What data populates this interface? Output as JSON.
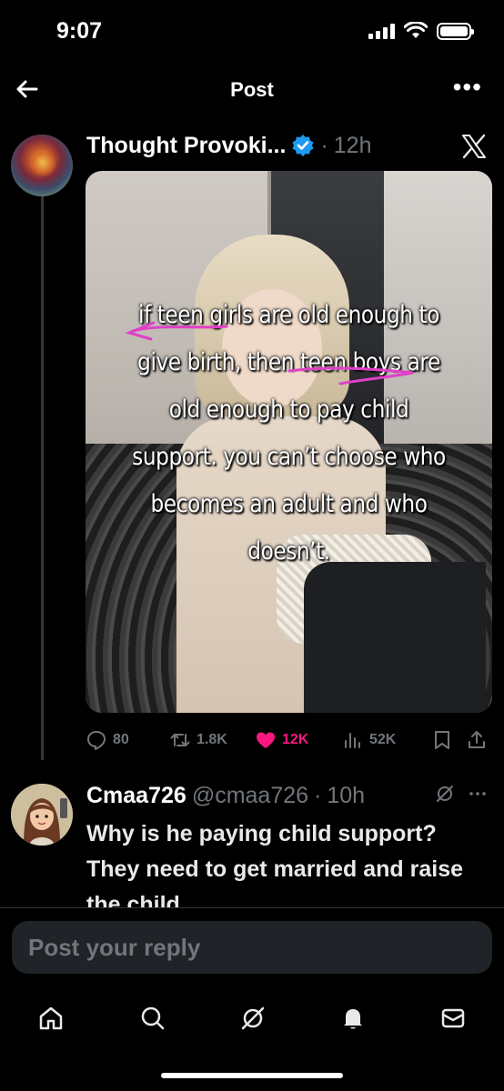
{
  "status_bar": {
    "time": "9:07"
  },
  "nav": {
    "title": "Post"
  },
  "post": {
    "author": "Thought Provoki...",
    "time": "12h",
    "meta_separator": "·",
    "image_text": "if teen girls are old enough to\ngive birth, then teen boys are\nold enough to pay child\nsupport. you can’t choose who\nbecomes an adult and who\ndoesn’t.",
    "actions": {
      "replies": "80",
      "reposts": "1.8K",
      "likes": "12K",
      "views": "52K"
    },
    "colors": {
      "like": "#f91880",
      "verified": "#1d9bf0",
      "annotation": "#e040c8"
    }
  },
  "reply": {
    "name": "Cmaa726",
    "handle": "@cmaa726",
    "time": "10h",
    "meta_separator": "·",
    "text": "Why is he paying child support? They need to get married and raise the child"
  },
  "composer": {
    "placeholder": "Post your reply"
  },
  "tabs": [
    "home-icon",
    "search-icon",
    "grok-icon",
    "notifications-icon",
    "messages-icon"
  ]
}
